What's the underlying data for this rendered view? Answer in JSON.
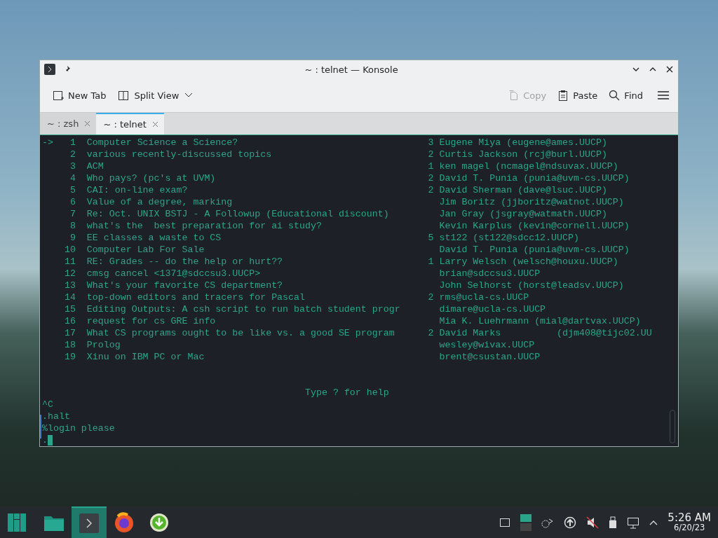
{
  "window": {
    "title": "~ : telnet — Konsole"
  },
  "toolbar": {
    "buttons": [
      {
        "kind": "newtab",
        "label": "New Tab",
        "disabled": false
      },
      {
        "kind": "split",
        "label": "Split View",
        "disabled": false
      }
    ],
    "right_buttons": [
      {
        "kind": "copy",
        "label": "Copy",
        "disabled": true
      },
      {
        "kind": "paste",
        "label": "Paste",
        "disabled": false
      },
      {
        "kind": "find",
        "label": "Find",
        "disabled": false
      }
    ]
  },
  "tabs": [
    {
      "label": "~ : zsh",
      "selected": false
    },
    {
      "label": "~ : telnet",
      "selected": true
    }
  ],
  "terminal": {
    "threads": [
      {
        "marker": "->",
        "number": "1",
        "subject": "Computer Science a Science?",
        "count": "3",
        "author": "Eugene Miya (eugene@ames.UUCP)"
      },
      {
        "number": "2",
        "subject": "various recently-discussed topics",
        "count": "2",
        "author": "Curtis Jackson (rcj@burl.UUCP)"
      },
      {
        "number": "3",
        "subject": "ACM",
        "count": "1",
        "author": "ken magel (ncmagel@ndsuvax.UUCP)"
      },
      {
        "number": "4",
        "subject": "Who pays? (pc's at UVM)",
        "count": "2",
        "author": "David T. Punia (punia@uvm-cs.UUCP)"
      },
      {
        "number": "5",
        "subject": "CAI: on-line exam?",
        "count": "2",
        "author": "David Sherman (dave@lsuc.UUCP)"
      },
      {
        "number": "6",
        "subject": "Value of a degree, marking",
        "author": "Jim Boritz (jjboritz@watnot.UUCP)"
      },
      {
        "number": "7",
        "subject": "Re: Oct. UNIX BSTJ - A Followup (Educational discount)",
        "author": "Jan Gray (jsgray@watmath.UUCP)"
      },
      {
        "number": "8",
        "subject": "what's the  best preparation for ai study?",
        "author": "Kevin Karplus (kevin@cornell.UUCP)"
      },
      {
        "number": "9",
        "subject": "EE classes a waste to CS",
        "count": "5",
        "author": "st122 (st122@sdcc12.UUCP)"
      },
      {
        "number": "10",
        "subject": "Computer Lab For Sale",
        "author": "David T. Punia (punia@uvm-cs.UUCP)"
      },
      {
        "number": "11",
        "subject": "RE: Grades -- do the help or hurt??",
        "count": "1",
        "author": "Larry Welsch (welsch@houxu.UUCP)"
      },
      {
        "number": "12",
        "subject": "cmsg cancel <1371@sdccsu3.UUCP>",
        "author": "brian@sdccsu3.UUCP"
      },
      {
        "number": "13",
        "subject": "What's your favorite CS department?",
        "author": "John Selhorst (horst@leadsv.UUCP)"
      },
      {
        "number": "14",
        "subject": "top-down editors and tracers for Pascal",
        "count": "2",
        "author": "rms@ucla-cs.UUCP"
      },
      {
        "number": "15",
        "subject": "Editing Outputs: A csh script to run batch student progr",
        "author": "dimare@ucla-cs.UUCP"
      },
      {
        "number": "16",
        "subject": "request for cs GRE info",
        "author": "Mia K. Luehrmann (mial@dartvax.UUCP)"
      },
      {
        "number": "17",
        "subject": "What CS programs ought to be like vs. a good SE program",
        "count": "2",
        "author": "David Marks          (djm408@tijc02.UU"
      },
      {
        "number": "18",
        "subject": "Prolog",
        "author": "wesley@wivax.UUCP"
      },
      {
        "number": "19",
        "subject": "Xinu on IBM PC or Mac",
        "author": "brent@csustan.UUCP"
      }
    ],
    "help_line": "Type ? for help",
    "output_lines": [
      "^C",
      ".halt",
      "%login please",
      "."
    ]
  },
  "taskbar": {
    "apps": [
      {
        "kind": "files",
        "selected": false
      },
      {
        "kind": "terminal",
        "selected": true
      },
      {
        "kind": "browser",
        "selected": false
      },
      {
        "kind": "download",
        "selected": false
      }
    ],
    "clock": {
      "time": "5:26 AM",
      "date": "6/20/23"
    }
  }
}
